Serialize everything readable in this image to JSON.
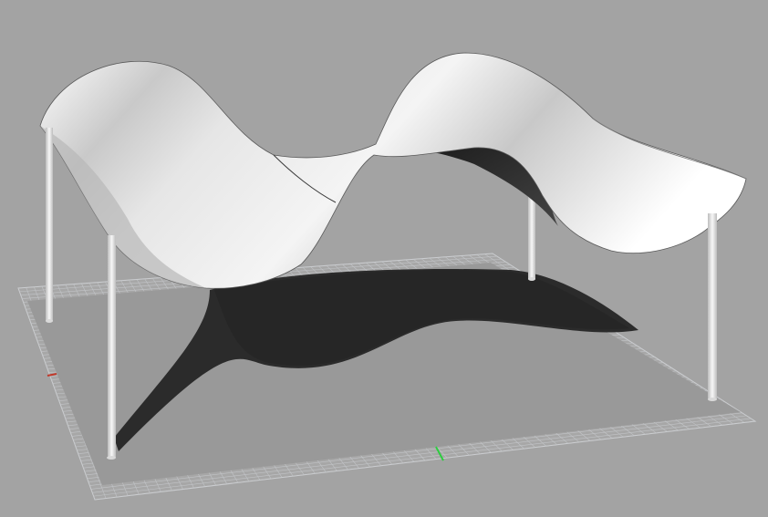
{
  "viewport": {
    "background_color": "#a3a3a3",
    "grid_color": "#c4c6c9",
    "grid_major_color": "#d6d8db",
    "ground_shadow_color": "#2b2b2b",
    "x_axis_color": "#c0392b",
    "y_axis_color": "#2ecc40",
    "canopy_highlight_color": "#f0f0f0",
    "canopy_shade_color": "#9a9a9a",
    "column_color": "#ececec"
  },
  "model": {
    "object": "tensile-canopy",
    "supports": 4
  }
}
